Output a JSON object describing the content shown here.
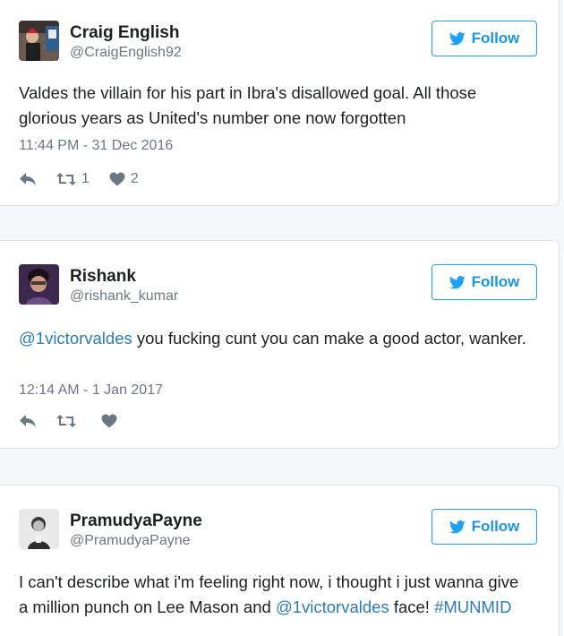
{
  "colors": {
    "link": "#2b7bb9",
    "follow_border": "#1da1f2",
    "muted": "#697882",
    "card_border": "#dfe3e6"
  },
  "tweets": [
    {
      "name": "Craig English",
      "handle": "@CraigEnglish92",
      "follow_label": "Follow",
      "text_parts": [
        {
          "type": "text",
          "value": "Valdes the villain for his part in Ibra's disallowed goal. All those glorious years as United's number one now forgotten"
        }
      ],
      "timestamp": "11:44 PM - 31 Dec 2016",
      "retweets": "1",
      "likes": "2",
      "icons": [
        "reply-icon",
        "retweet-icon",
        "heart-icon"
      ]
    },
    {
      "name": "Rishank",
      "handle": "@rishank_kumar",
      "follow_label": "Follow",
      "text_parts": [
        {
          "type": "mention",
          "value": "@1victorvaldes"
        },
        {
          "type": "text",
          "value": " you fucking cunt you can make a good actor, wanker."
        }
      ],
      "timestamp": "12:14 AM - 1 Jan 2017",
      "retweets": "",
      "likes": "",
      "icons": [
        "reply-icon",
        "retweet-icon",
        "heart-icon"
      ]
    },
    {
      "name": "PramudyaPayne",
      "handle": "@PramudyaPayne",
      "follow_label": "Follow",
      "text_parts": [
        {
          "type": "text",
          "value": "I can't describe what i'm feeling right now, i thought i just wanna give a million punch on Lee Mason and "
        },
        {
          "type": "mention",
          "value": "@1victorvaldes"
        },
        {
          "type": "text",
          "value": " face! "
        },
        {
          "type": "hashtag",
          "value": "#MUNMID"
        }
      ]
    }
  ]
}
